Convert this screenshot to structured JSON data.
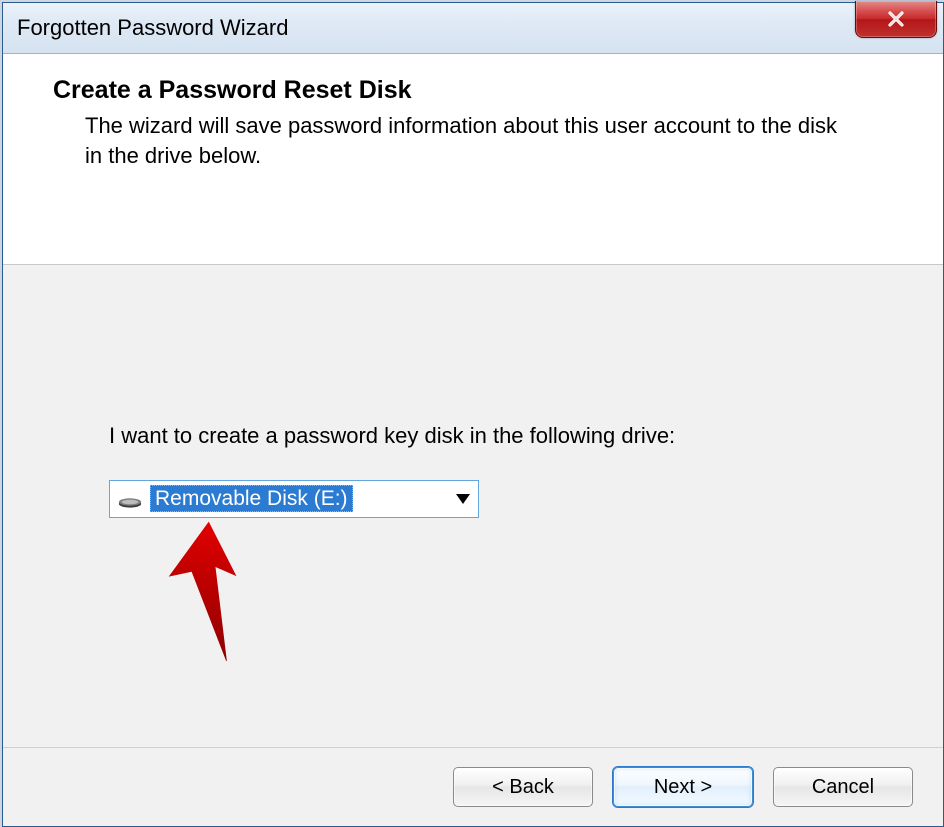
{
  "window": {
    "title": "Forgotten Password Wizard"
  },
  "header": {
    "title": "Create a Password Reset Disk",
    "description": "The wizard will save password information about this user account to the disk in the drive below."
  },
  "body": {
    "prompt": "I want to create a password key disk in the following drive:",
    "drive_selected": "Removable Disk (E:)"
  },
  "buttons": {
    "back": "< Back",
    "next": "Next >",
    "cancel": "Cancel"
  }
}
